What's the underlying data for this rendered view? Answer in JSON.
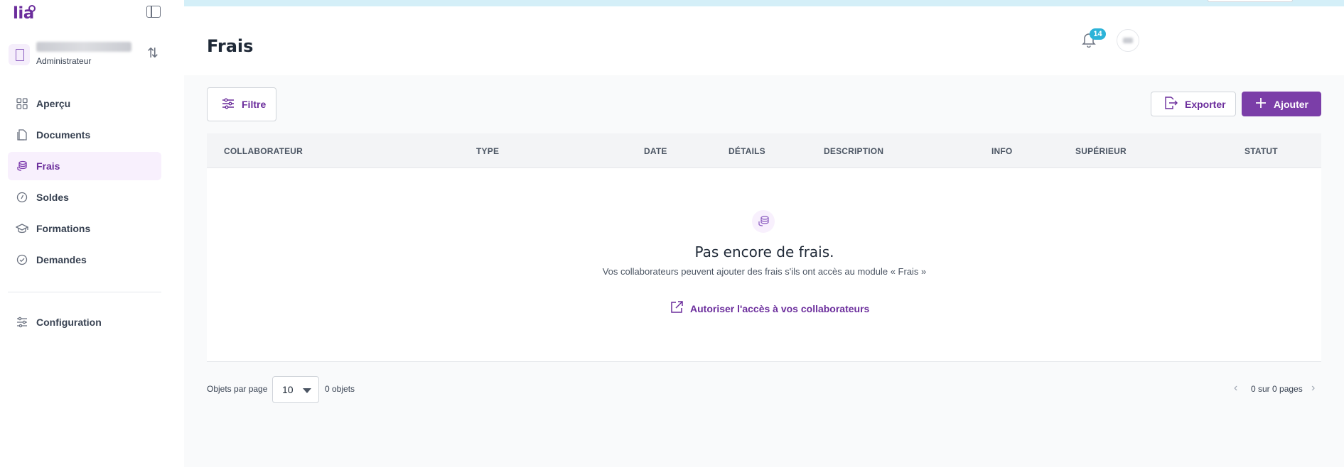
{
  "app": {
    "logo_text": "lia"
  },
  "org": {
    "name": "",
    "role": "Administrateur"
  },
  "nav": {
    "items": [
      {
        "label": "Aperçu",
        "icon": "grid-icon"
      },
      {
        "label": "Documents",
        "icon": "document-icon"
      },
      {
        "label": "Frais",
        "icon": "coins-icon",
        "active": true
      },
      {
        "label": "Soldes",
        "icon": "clock-icon"
      },
      {
        "label": "Formations",
        "icon": "graduation-cap-icon"
      },
      {
        "label": "Demandes",
        "icon": "check-circle-icon"
      }
    ],
    "config_label": "Configuration"
  },
  "header": {
    "title": "Frais",
    "notifications_count": "14"
  },
  "toolbar": {
    "filter_label": "Filtre",
    "export_label": "Exporter",
    "add_label": "Ajouter"
  },
  "table": {
    "columns": [
      "COLLABORATEUR",
      "TYPE",
      "DATE",
      "DÉTAILS",
      "DESCRIPTION",
      "INFO",
      "SUPÉRIEUR",
      "STATUT"
    ]
  },
  "empty_state": {
    "title": "Pas encore de frais.",
    "subtitle": "Vos collaborateurs peuvent ajouter des frais s'ils ont accès au module « Frais »",
    "link_label": "Autoriser l'accès à vos collaborateurs"
  },
  "pagination": {
    "per_page_label": "Objets par page",
    "per_page_value": "10",
    "count_label": "0 objets",
    "pages_label": "0 sur 0 pages"
  },
  "colors": {
    "brand": "#7b3ea8",
    "brand_text": "#6b2d9c",
    "badge": "#2db3d8",
    "topbar": "#d4eff8"
  }
}
